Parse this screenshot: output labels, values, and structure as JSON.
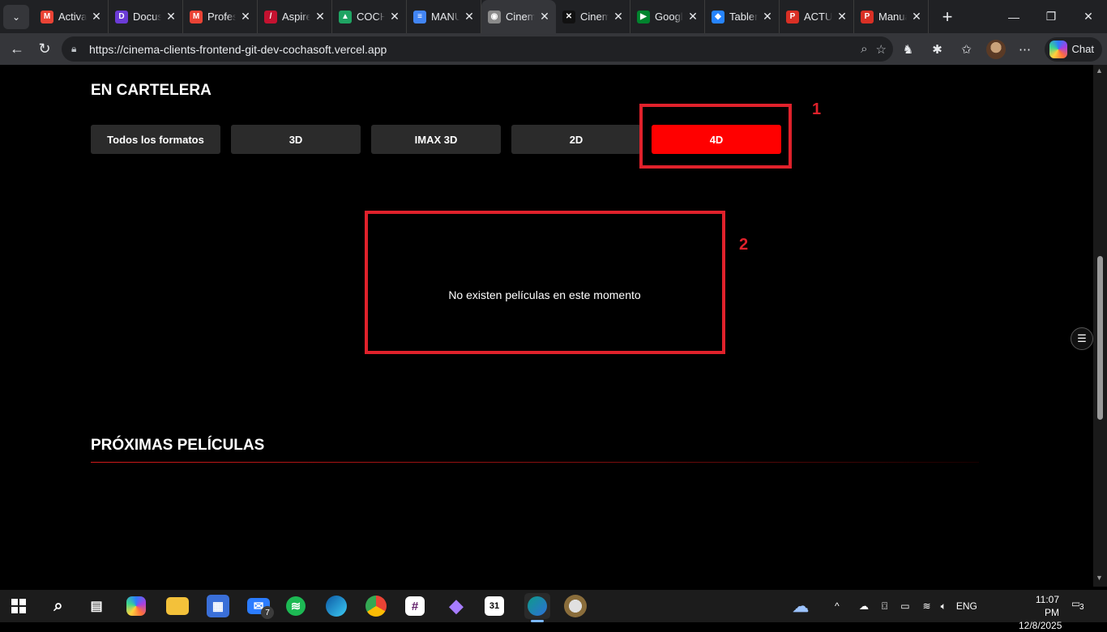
{
  "browser": {
    "tabs": [
      {
        "label": "Activac",
        "icon": "gmail-icon",
        "color": "#ea4335",
        "glyph": "M"
      },
      {
        "label": "Docusi",
        "icon": "docusign-icon",
        "color": "#6b3bd6",
        "glyph": "D"
      },
      {
        "label": "Profess",
        "icon": "gmail-icon",
        "color": "#ea4335",
        "glyph": "M"
      },
      {
        "label": "Aspire",
        "icon": "aspire-icon",
        "color": "#c41230",
        "glyph": "/"
      },
      {
        "label": "COCHA",
        "icon": "google-drive-icon",
        "color": "#1fa463",
        "glyph": "▲"
      },
      {
        "label": "MANU",
        "icon": "google-docs-icon",
        "color": "#4285f4",
        "glyph": "≡"
      },
      {
        "label": "Cinema",
        "icon": "github-icon",
        "color": "#8a8a8a",
        "glyph": "◉",
        "active": true
      },
      {
        "label": "Cinema",
        "icon": "vercel-icon",
        "color": "#111111",
        "glyph": "✕"
      },
      {
        "label": "Google",
        "icon": "google-meet-icon",
        "color": "#00832d",
        "glyph": "▶"
      },
      {
        "label": "Tablero",
        "icon": "jira-icon",
        "color": "#2684ff",
        "glyph": "◆"
      },
      {
        "label": "ACTUA",
        "icon": "pdf-icon",
        "color": "#d93025",
        "glyph": "P"
      },
      {
        "label": "Manua",
        "icon": "pdf-icon",
        "color": "#d93025",
        "glyph": "P"
      }
    ],
    "url": "https://cinema-clients-frontend-git-dev-cochasoft.vercel.app",
    "chat_label": "Chat"
  },
  "page": {
    "now_showing_title": "EN CARTELERA",
    "format_filters": [
      {
        "label": "Todos los formatos",
        "active": false
      },
      {
        "label": "3D",
        "active": false
      },
      {
        "label": "IMAX 3D",
        "active": false
      },
      {
        "label": "2D",
        "active": false
      },
      {
        "label": "4D",
        "active": true
      }
    ],
    "empty_message": "No existen películas en este momento",
    "upcoming_title": "PRÓXIMAS PELÍCULAS",
    "annotations": [
      "1",
      "2"
    ],
    "accent_color": "#ff0000",
    "annotation_color": "#e0212b"
  },
  "taskbar": {
    "language": "ENG",
    "time": "11:07 PM",
    "date": "12/8/2025",
    "mail_badge": "7",
    "notification_count": "3"
  }
}
